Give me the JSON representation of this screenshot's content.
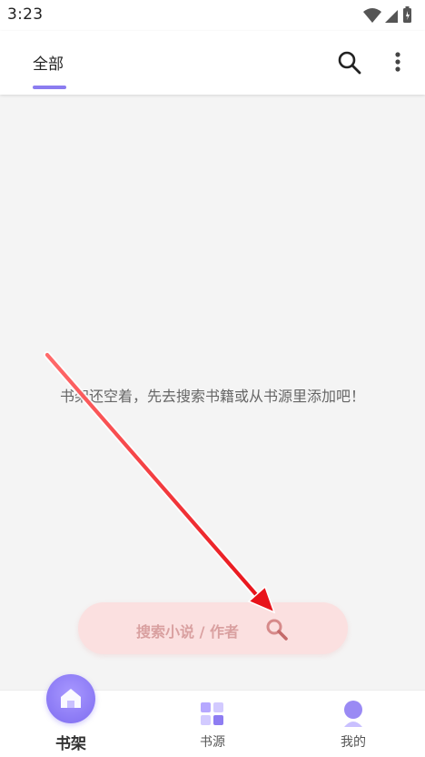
{
  "status_bar": {
    "time": "3:23"
  },
  "header": {
    "tab_label": "全部"
  },
  "main": {
    "empty_message": "书架还空着，先去搜索书籍或从书源里添加吧！"
  },
  "search_pill": {
    "label": "搜索小说 / 作者"
  },
  "bottom_nav": {
    "items": [
      {
        "label": "书架",
        "icon": "bookshelf-house-icon",
        "active": true
      },
      {
        "label": "书源",
        "icon": "grid-squares-icon",
        "active": false
      },
      {
        "label": "我的",
        "icon": "user-avatar-icon",
        "active": false
      }
    ]
  },
  "colors": {
    "accent": "#8b7cf0",
    "search_pill_bg": "#fbe0e0",
    "annotation_arrow": "#e8131a"
  }
}
